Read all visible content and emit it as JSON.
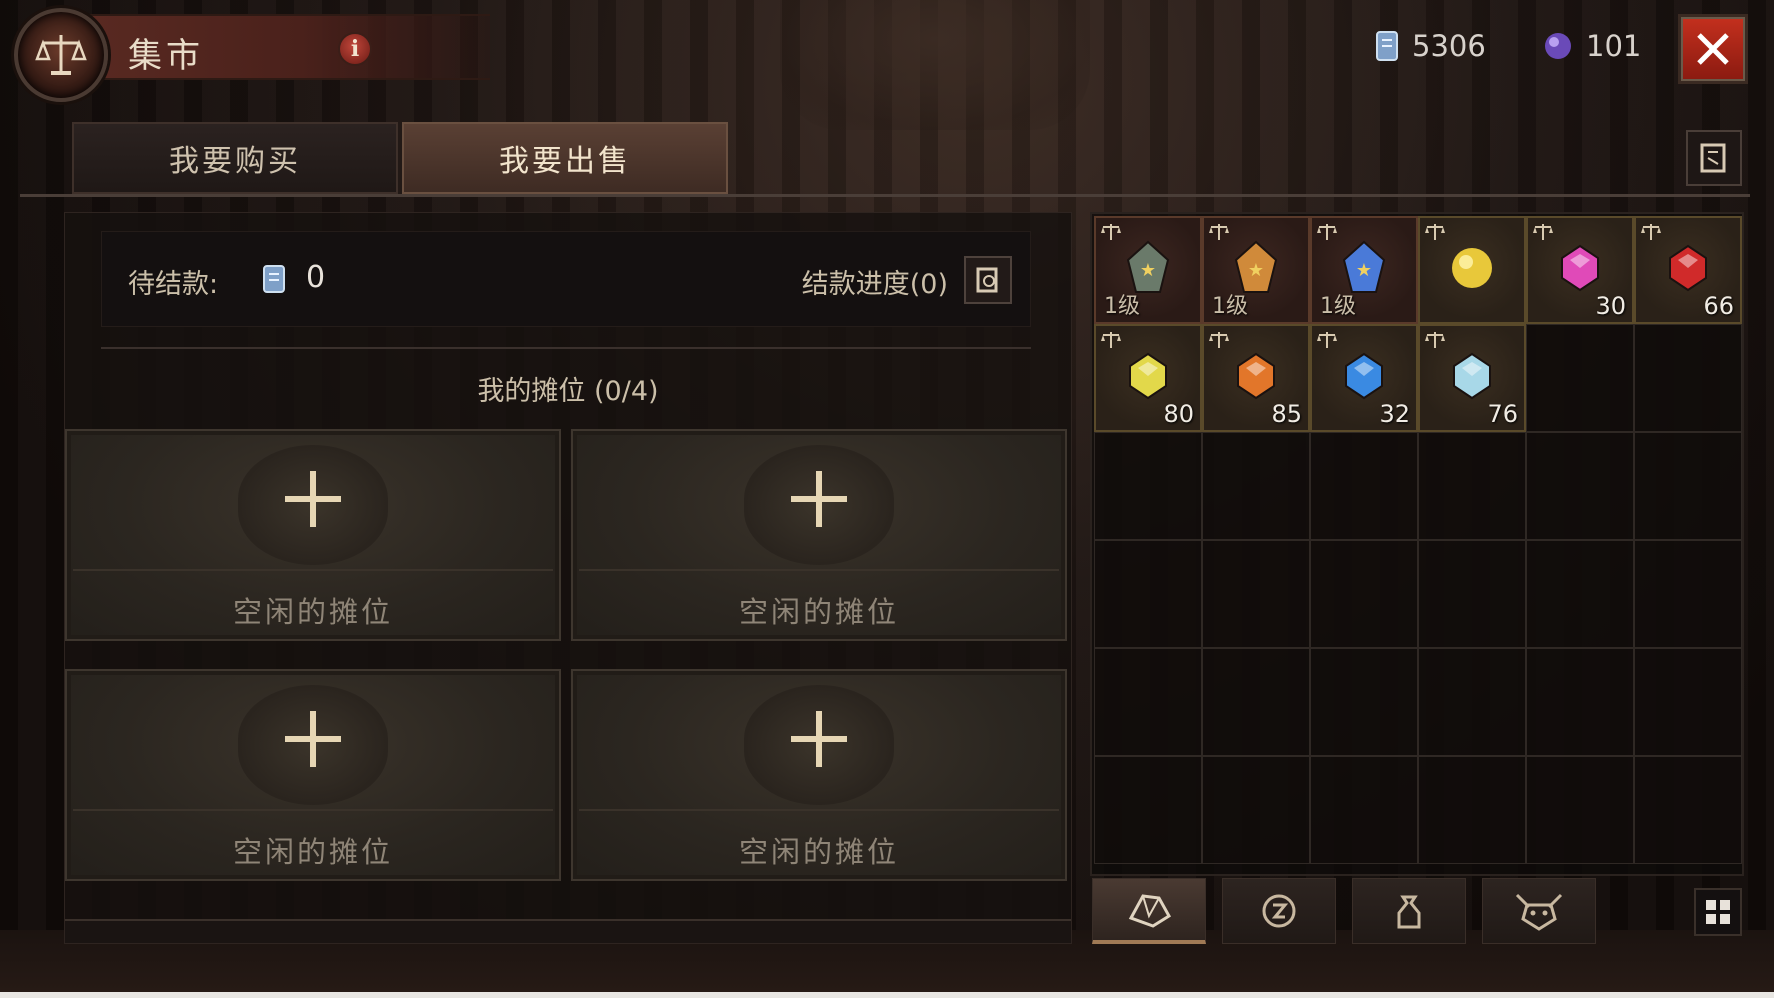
{
  "header": {
    "title": "集市",
    "info_icon": "info-icon",
    "currencies": [
      {
        "icon": "platinum-scroll-icon",
        "value": "5306",
        "color": "#8fb0d8"
      },
      {
        "icon": "purple-orb-icon",
        "value": "101",
        "color": "#8a6ad8"
      }
    ],
    "close_icon": "close-icon",
    "close_color": "#c4301e"
  },
  "tabs": [
    {
      "label": "我要购买",
      "active": false
    },
    {
      "label": "我要出售",
      "active": true
    }
  ],
  "left": {
    "pending_label": "待结款:",
    "pending_value": "0",
    "progress_label": "结款进度(0)",
    "stalls_title": "我的摊位 (0/4)",
    "stalls": [
      {
        "label": "空闲的摊位"
      },
      {
        "label": "空闲的摊位"
      },
      {
        "label": "空闲的摊位"
      },
      {
        "label": "空闲的摊位"
      }
    ]
  },
  "inventory": {
    "items": [
      {
        "icon": "crest-star-gem-icon",
        "level": "1级",
        "count": "",
        "color": "#6a7a6a"
      },
      {
        "icon": "amber-star-gem-icon",
        "level": "1级",
        "count": "",
        "color": "#d08a3a"
      },
      {
        "icon": "blue-star-gem-icon",
        "level": "1级",
        "count": "",
        "color": "#4a7ad8"
      },
      {
        "icon": "gold-orb-icon",
        "level": "",
        "count": "",
        "color": "#e8c83a"
      },
      {
        "icon": "pink-gem-icon",
        "level": "",
        "count": "30",
        "color": "#e04ab8"
      },
      {
        "icon": "red-gem-icon",
        "level": "",
        "count": "66",
        "color": "#d02a2a"
      },
      {
        "icon": "yellow-gem-icon",
        "level": "",
        "count": "80",
        "color": "#e2d84a"
      },
      {
        "icon": "orange-gem-icon",
        "level": "",
        "count": "85",
        "color": "#e2762a"
      },
      {
        "icon": "blue-gem-icon",
        "level": "",
        "count": "32",
        "color": "#3a8ae2"
      },
      {
        "icon": "diamond-gem-icon",
        "level": "",
        "count": "76",
        "color": "#a8d8e8"
      }
    ],
    "total_slots": 36,
    "categories": [
      {
        "icon": "gem-category-icon",
        "active": true
      },
      {
        "icon": "rune-category-icon",
        "active": false
      },
      {
        "icon": "bag-category-icon",
        "active": false
      },
      {
        "icon": "demon-category-icon",
        "active": false
      }
    ]
  }
}
